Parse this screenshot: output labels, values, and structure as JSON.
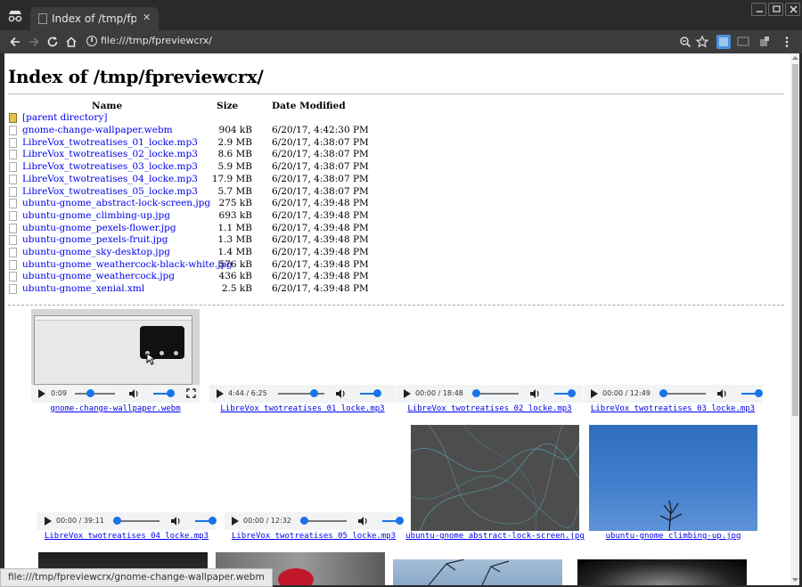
{
  "window": {
    "tab_title": "Index of /tmp/fprevi",
    "url": "file:///tmp/fpreviewcrx/"
  },
  "page": {
    "heading": "Index of /tmp/fpreviewcrx/",
    "col_name": "Name",
    "col_size": "Size",
    "col_date": "Date Modified",
    "parent": "[parent directory]",
    "files": [
      {
        "name": "gnome-change-wallpaper.webm",
        "size": "904 kB",
        "date": "6/20/17, 4:42:30 PM"
      },
      {
        "name": "LibreVox_twotreatises_01_locke.mp3",
        "size": "2.9 MB",
        "date": "6/20/17, 4:38:07 PM"
      },
      {
        "name": "LibreVox_twotreatises_02_locke.mp3",
        "size": "8.6 MB",
        "date": "6/20/17, 4:38:07 PM"
      },
      {
        "name": "LibreVox_twotreatises_03_locke.mp3",
        "size": "5.9 MB",
        "date": "6/20/17, 4:38:07 PM"
      },
      {
        "name": "LibreVox_twotreatises_04_locke.mp3",
        "size": "17.9 MB",
        "date": "6/20/17, 4:38:07 PM"
      },
      {
        "name": "LibreVox_twotreatises_05_locke.mp3",
        "size": "5.7 MB",
        "date": "6/20/17, 4:38:07 PM"
      },
      {
        "name": "ubuntu-gnome_abstract-lock-screen.jpg",
        "size": "275 kB",
        "date": "6/20/17, 4:39:48 PM"
      },
      {
        "name": "ubuntu-gnome_climbing-up.jpg",
        "size": "693 kB",
        "date": "6/20/17, 4:39:48 PM"
      },
      {
        "name": "ubuntu-gnome_pexels-flower.jpg",
        "size": "1.1 MB",
        "date": "6/20/17, 4:39:48 PM"
      },
      {
        "name": "ubuntu-gnome_pexels-fruit.jpg",
        "size": "1.3 MB",
        "date": "6/20/17, 4:39:48 PM"
      },
      {
        "name": "ubuntu-gnome_sky-desktop.jpg",
        "size": "1.4 MB",
        "date": "6/20/17, 4:39:48 PM"
      },
      {
        "name": "ubuntu-gnome_weathercock-black-white.jpg",
        "size": "576 kB",
        "date": "6/20/17, 4:39:48 PM"
      },
      {
        "name": "ubuntu-gnome_weathercock.jpg",
        "size": "436 kB",
        "date": "6/20/17, 4:39:48 PM"
      },
      {
        "name": "ubuntu-gnome_xenial.xml",
        "size": "2.5 kB",
        "date": "6/20/17, 4:39:48 PM"
      }
    ]
  },
  "previews": {
    "video": {
      "time": "0:09",
      "caption": "gnome-change-wallpaper.webm"
    },
    "audio": [
      {
        "time": "4:44 / 6:25",
        "caption": "LibreVox_twotreatises_01_locke.mp3"
      },
      {
        "time": "00:00 / 18:48",
        "caption": "LibreVox_twotreatises_02_locke.mp3"
      },
      {
        "time": "00:00 / 12:49",
        "caption": "LibreVox_twotreatises_03_locke.mp3"
      },
      {
        "time": "00:00 / 39:11",
        "caption": "LibreVox_twotreatises_04_locke.mp3"
      },
      {
        "time": "00:00 / 12:32",
        "caption": "LibreVox_twotreatises_05_locke.mp3"
      }
    ],
    "images": [
      {
        "caption": "ubuntu-gnome_abstract-lock-screen.jpg"
      },
      {
        "caption": "ubuntu-gnome_climbing-up.jpg"
      }
    ]
  },
  "status_bar": "file:///tmp/fpreviewcrx/gnome-change-wallpaper.webm"
}
